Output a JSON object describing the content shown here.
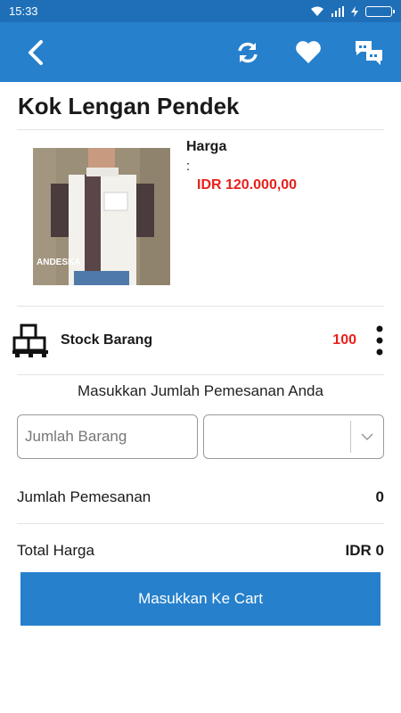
{
  "status_bar": {
    "time": "15:33"
  },
  "app_bar": {
    "back_icon": "back-chevron-icon",
    "actions": [
      "refresh-icon",
      "heart-icon",
      "chat-icon"
    ]
  },
  "product": {
    "title": "Kok Lengan Pendek",
    "price_label": "Harga",
    "price_colon": ":",
    "price_value": "IDR 120.000,00",
    "image_watermark": "ANDESKA"
  },
  "stock": {
    "label": "Stock Barang",
    "value": "100"
  },
  "order": {
    "prompt": "Masukkan Jumlah Pemesanan Anda",
    "qty_placeholder": "Jumlah Barang",
    "unit_selected": ""
  },
  "summary": {
    "qty_label": "Jumlah Pemesanan",
    "qty_value": "0",
    "total_label": "Total Harga",
    "total_value": "IDR 0"
  },
  "cart_button": {
    "label": "Masukkan Ke Cart"
  },
  "colors": {
    "primary": "#2680cc",
    "status_bar": "#1f6fb8",
    "accent_red": "#e8201c"
  }
}
